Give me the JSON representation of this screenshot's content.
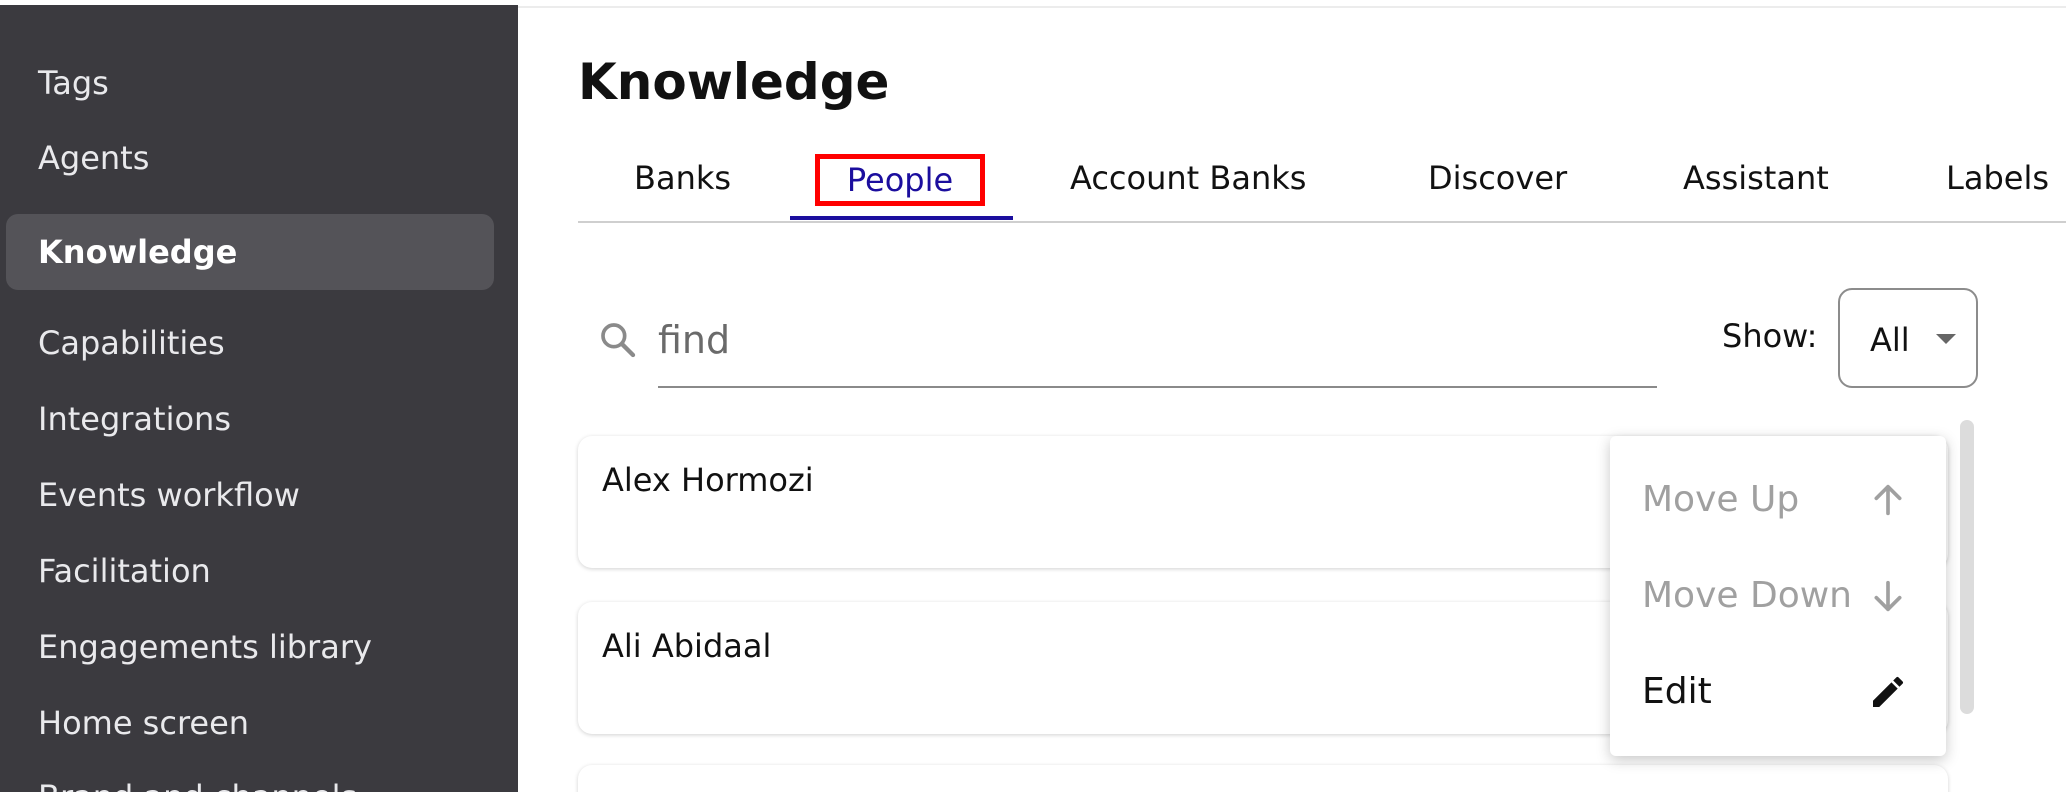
{
  "sidebar": {
    "items": [
      {
        "label": "Tags"
      },
      {
        "label": "Agents"
      },
      {
        "label": "Knowledge"
      },
      {
        "label": "Capabilities"
      },
      {
        "label": "Integrations"
      },
      {
        "label": "Events workflow"
      },
      {
        "label": "Facilitation"
      },
      {
        "label": "Engagements library"
      },
      {
        "label": "Home screen"
      },
      {
        "label": "Brand and channels"
      }
    ],
    "active_index": 2
  },
  "page": {
    "title": "Knowledge"
  },
  "tabs": [
    {
      "label": "Banks"
    },
    {
      "label": "People"
    },
    {
      "label": "Account Banks"
    },
    {
      "label": "Discover"
    },
    {
      "label": "Assistant"
    },
    {
      "label": "Labels"
    }
  ],
  "active_tab": "People",
  "search": {
    "placeholder": "find"
  },
  "filter": {
    "label": "Show:",
    "value": "All"
  },
  "people": [
    {
      "name": "Alex Hormozi"
    },
    {
      "name": "Ali Abidaal"
    }
  ],
  "menu": {
    "items": [
      {
        "label": "Move Up",
        "icon": "arrow-up-icon",
        "enabled": false
      },
      {
        "label": "Move Down",
        "icon": "arrow-down-icon",
        "enabled": false
      },
      {
        "label": "Edit",
        "icon": "pencil-icon",
        "enabled": true
      }
    ]
  },
  "colors": {
    "sidebar_bg": "#3b3a3f",
    "sidebar_active": "#545358",
    "accent": "#1b0e9e",
    "highlight_box": "#ff0000"
  }
}
